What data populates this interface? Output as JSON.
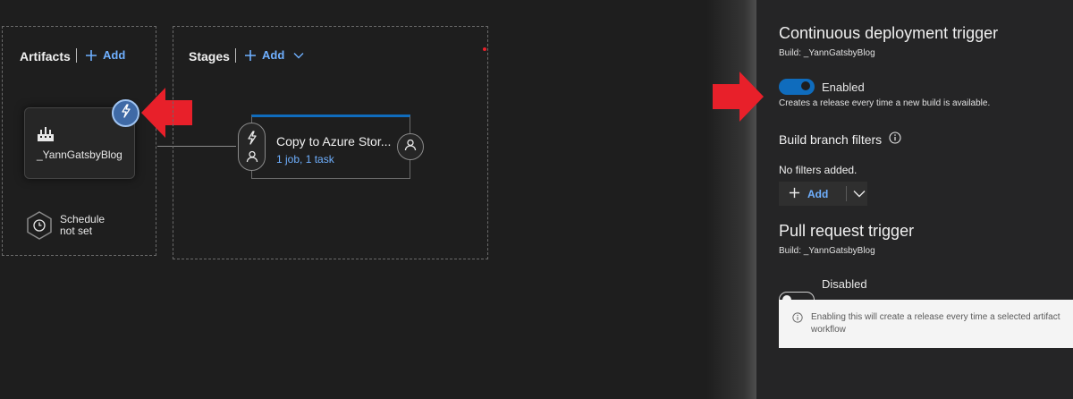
{
  "artifacts": {
    "title": "Artifacts",
    "add_label": "Add",
    "artifact_name": "_YannGatsbyBlog",
    "schedule_line1": "Schedule",
    "schedule_line2": "not set"
  },
  "stages": {
    "title": "Stages",
    "add_label": "Add",
    "stage_name": "Copy to Azure Stor...",
    "stage_meta": "1 job, 1 task"
  },
  "panel": {
    "cd_title": "Continuous deployment trigger",
    "cd_build": "Build: _YannGatsbyBlog",
    "cd_toggle_label": "Enabled",
    "cd_toggle_on": true,
    "cd_description": "Creates a release every time a new build is available.",
    "branch_filters_title": "Build branch filters",
    "no_filters": "No filters added.",
    "add_label": "Add",
    "pr_title": "Pull request trigger",
    "pr_build": "Build: _YannGatsbyBlog",
    "pr_toggle_label": "Disabled",
    "pr_toggle_on": false,
    "info_line1": "Enabling this will create a release every time a selected artifact",
    "info_line2": "workflow"
  },
  "colors": {
    "accent": "#0f6cbd",
    "link": "#6fb0ff",
    "arrow": "#e8202a"
  }
}
